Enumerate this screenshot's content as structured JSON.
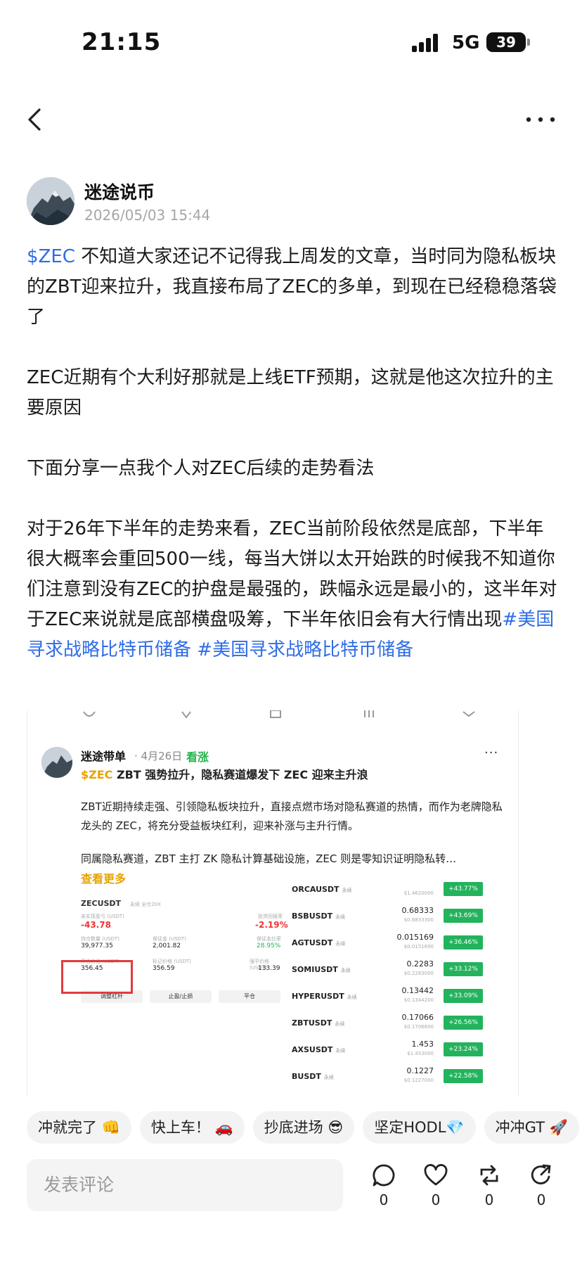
{
  "status_bar": {
    "time": "21:15",
    "network": "5G",
    "battery": "39"
  },
  "author": {
    "name": "迷途说币",
    "time": "2026/05/03 15:44"
  },
  "post": {
    "ticker": "$ZEC",
    "p1": " 不知道大家还记不记得我上周发的文章，当时同为隐私板块的ZBT迎来拉升，我直接布局了ZEC的多单，到现在已经稳稳落袋了",
    "p2": "ZEC近期有个大利好那就是上线ETF预期，这就是他这次拉升的主要原因",
    "p3": "下面分享一点我个人对ZEC后续的走势看法",
    "p4": "对于26年下半年的走势来看，ZEC当前阶段依然是底部，下半年很大概率会重回500一线，每当大饼以太开始跌的时候我不知道你们注意到没有ZEC的护盘是最强的，跌幅永远是最小的，这半年对于ZEC来说就是底部横盘吸筹，下半年依旧会有大行情出现",
    "hashtag1": "#美国寻求战略比特币储备",
    "hashtag2": " #美国寻求战略比特币储备"
  },
  "embed": {
    "name": "迷途带单",
    "date": "· 4月26日",
    "tag": "看涨",
    "more": "···",
    "title_ticker": "$ZEC",
    "title_rest": " ZBT 强势拉升，隐私赛道爆发下 ZEC 迎来主升浪",
    "para1": "ZBT近期持续走强、引领隐私板块拉升，直接点燃市场对隐私赛道的热情，而作为老牌隐私龙头的 ZEC，将充分受益板块红利，迎来补涨与主升行情。",
    "para2": "同属隐私赛道，ZBT 主打 ZK 隐私计算基础设施，ZEC 则是零知识证明隐私转…",
    "see_more": "查看更多",
    "position": {
      "symbol": "ZECUSDT",
      "symbol_tags": "永续  全仓20X",
      "pnl_label": "未实现盈亏 (USDT)",
      "pnl": "-43.78",
      "roe_label": "投资回报率",
      "roe": "-2.19%",
      "size_label": "持仓数量 (USDT)",
      "size": "39,977.35",
      "margin_label": "保证金 (USDT)",
      "margin": "2,001.82",
      "ratio_label": "保证金比率",
      "ratio": "28.95%",
      "entry_label": "开仓价格 (USDT)",
      "entry": "356.45",
      "mark_label": "标记价格 (USDT)",
      "mark": "356.59",
      "liq_label": "强平价格 (USDT)",
      "liq": "133.39",
      "btn1": "调整杠杆",
      "btn2": "止盈/止损",
      "btn3": "平仓"
    },
    "tickers": [
      {
        "sym": "ORCAUSDT",
        "tag": "永续",
        "price": "",
        "sub": "$1.4620000",
        "chg": "+43.77%"
      },
      {
        "sym": "BSBUSDT",
        "tag": "永续",
        "price": "0.68333",
        "sub": "$0.6833300",
        "chg": "+43.69%"
      },
      {
        "sym": "AGTUSDT",
        "tag": "永续",
        "price": "0.015169",
        "sub": "$0.0151690",
        "chg": "+36.46%"
      },
      {
        "sym": "SOMIUSDT",
        "tag": "永续",
        "price": "0.2283",
        "sub": "$0.2283000",
        "chg": "+33.12%"
      },
      {
        "sym": "HYPERUSDT",
        "tag": "永续",
        "price": "0.13442",
        "sub": "$0.1344200",
        "chg": "+33.09%"
      },
      {
        "sym": "ZBTUSDT",
        "tag": "永续",
        "price": "0.17066",
        "sub": "$0.1706600",
        "chg": "+26.56%"
      },
      {
        "sym": "AXSUSDT",
        "tag": "永续",
        "price": "1.453",
        "sub": "$1.453000",
        "chg": "+23.24%"
      },
      {
        "sym": "BUSDT",
        "tag": "永续",
        "price": "0.1227",
        "sub": "$0.1227000",
        "chg": "+22.58%"
      }
    ]
  },
  "chips": [
    "冲就完了 👊",
    "快上车！ 🚗",
    "抄底进场 😎",
    "坚定HODL💎",
    "冲冲GT 🚀"
  ],
  "comment_placeholder": "发表评论",
  "actions": {
    "comment": "0",
    "like": "0",
    "repost": "0",
    "share": "0"
  },
  "colors": {
    "link": "#2f6de6",
    "up": "#22b35c",
    "down": "#e33333",
    "embed_accent": "#e8a300"
  }
}
